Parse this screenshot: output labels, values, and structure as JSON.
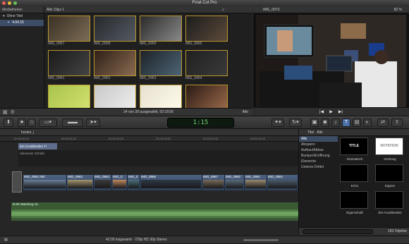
{
  "app": {
    "title": "Final Cut Pro"
  },
  "library": {
    "header": "Mediatheken",
    "items": [
      {
        "label": "Ohne Titel",
        "selected": false
      },
      {
        "label": "4.04.15",
        "selected": true
      }
    ]
  },
  "browser": {
    "filter_label": "Alle Clips",
    "filter_count": "1",
    "clips": [
      "IMG_0957",
      "IMG_0958",
      "IMG_0959",
      "IMG_0960",
      "IMG_0961",
      "IMG_0962",
      "IMG_0963",
      "IMG_0964",
      "IMG_0969",
      "IMG_0971",
      "IMG_0972",
      "IMG_0973",
      "",
      "",
      "",
      ""
    ],
    "status": "24 von 28 ausgewählt, 02:18:06",
    "filter_right": "Alle"
  },
  "viewer": {
    "clip_name": "IMG_0973",
    "zoom": "82 %"
  },
  "toolbar": {
    "timecode": "1:15"
  },
  "timeline": {
    "project": "hordur_i",
    "ruler": [
      "00:00:00:00",
      "00:00:05:00",
      "00:00:10:00",
      "00:00:15:00",
      "00:00:20:00",
      "00:00:25:00"
    ],
    "title_track": "Ein-/Ausblenden Ti",
    "connected_track": "Voiceover Schnitt",
    "primary_clips": [
      {
        "label": "IMG_0961 062",
        "w": 62
      },
      {
        "label": "IMG_0963",
        "w": 38
      },
      {
        "label": "IMG_0964",
        "w": 26
      },
      {
        "label": "IMG_0",
        "w": 22
      },
      {
        "label": "IMG_0",
        "w": 18
      },
      {
        "label": "IMG_0968",
        "w": 88
      },
      {
        "label": "IMG_0967",
        "w": 32
      },
      {
        "label": "IMG_0962",
        "w": 28
      },
      {
        "label": "IMG_0961",
        "w": 32
      },
      {
        "label": "IMG_0964",
        "w": 44
      }
    ],
    "audio_track": "B-08 Watching Va",
    "status": "42:00 insgesamt - 720p HD 30p Stereo"
  },
  "titles": {
    "header_label": "Titel",
    "header_filter": "Alle",
    "categories": [
      {
        "label": "Alle",
        "selected": true
      },
      {
        "label": "Abspann",
        "selected": false
      },
      {
        "label": "Aufbau/Abbau",
        "selected": false
      },
      {
        "label": "Bumper/Eröffnung",
        "selected": false
      },
      {
        "label": "Elemente",
        "selected": false
      },
      {
        "label": "Unteres Drittel",
        "selected": false
      }
    ],
    "items": [
      {
        "caption": "Dramatisch",
        "text": "TITLE"
      },
      {
        "caption": "Drehung",
        "text": "ROTATION"
      },
      {
        "caption": "Echo",
        "text": ""
      },
      {
        "caption": "Eigene",
        "text": ""
      },
      {
        "caption": "Eigenschaft",
        "text": ""
      },
      {
        "caption": "Ein-/Ausblenden",
        "text": ""
      }
    ],
    "count": "183 Objekte"
  }
}
